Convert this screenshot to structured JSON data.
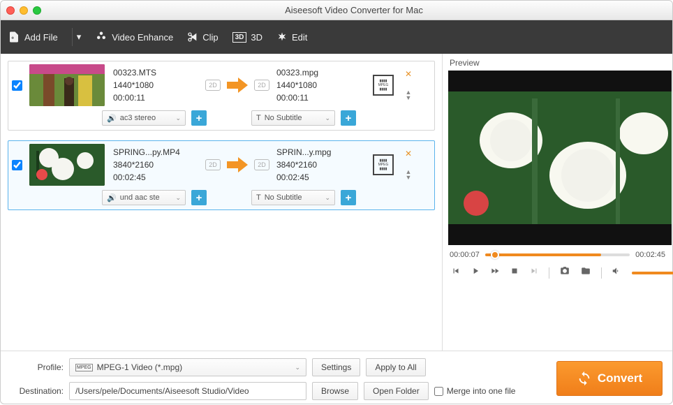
{
  "window": {
    "title": "Aiseesoft Video Converter for Mac"
  },
  "toolbar": {
    "add_file": "Add File",
    "video_enhance": "Video Enhance",
    "clip": "Clip",
    "three_d": "3D",
    "edit": "Edit"
  },
  "items": [
    {
      "src_name": "00323.MTS",
      "src_res": "1440*1080",
      "src_dur": "00:00:11",
      "dst_name": "00323.mpg",
      "dst_res": "1440*1080",
      "dst_dur": "00:00:11",
      "badge_src": "2D",
      "badge_dst": "2D",
      "audio": "ac3 stereo",
      "subtitle": "No Subtitle",
      "checked": true
    },
    {
      "src_name": "SPRING...py.MP4",
      "src_res": "3840*2160",
      "src_dur": "00:02:45",
      "dst_name": "SPRIN...y.mpg",
      "dst_res": "3840*2160",
      "dst_dur": "00:02:45",
      "badge_src": "2D",
      "badge_dst": "2D",
      "audio": "und aac ste",
      "subtitle": "No Subtitle",
      "checked": true
    }
  ],
  "preview": {
    "label": "Preview",
    "current": "00:00:07",
    "total": "00:02:45",
    "progress_pct": 4
  },
  "footer": {
    "profile_label": "Profile:",
    "profile_value": "MPEG-1 Video (*.mpg)",
    "destination_label": "Destination:",
    "destination_value": "/Users/pele/Documents/Aiseesoft Studio/Video",
    "settings": "Settings",
    "apply_all": "Apply to All",
    "browse": "Browse",
    "open_folder": "Open Folder",
    "merge": "Merge into one file",
    "convert": "Convert"
  }
}
